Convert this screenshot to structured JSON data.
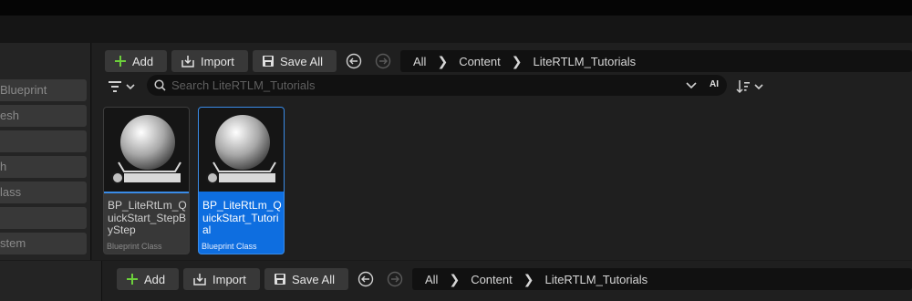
{
  "sidebar": {
    "items": [
      {
        "label": "Blueprint"
      },
      {
        "label": "esh"
      },
      {
        "label": ""
      },
      {
        "label": "h"
      },
      {
        "label": "lass"
      },
      {
        "label": ""
      },
      {
        "label": "stem"
      }
    ]
  },
  "toolbar": {
    "add_label": "Add",
    "import_label": "Import",
    "save_all_label": "Save All"
  },
  "breadcrumb": {
    "items": [
      "All",
      "Content",
      "LiteRTLM_Tutorials"
    ]
  },
  "search": {
    "placeholder": "Search LiteRTLM_Tutorials",
    "ai_label": "AI"
  },
  "assets": [
    {
      "name": "BP_LiteRtLm_QuickStart_StepByStep",
      "class": "Blueprint Class",
      "selected": false
    },
    {
      "name": "BP_LiteRtLm_QuickStart_Tutorial",
      "class": "Blueprint Class",
      "selected": true
    }
  ],
  "lower_toolbar": {
    "add_label": "Add",
    "import_label": "Import",
    "save_all_label": "Save All",
    "breadcrumb": [
      "All",
      "Content",
      "LiteRTLM_Tutorials"
    ]
  },
  "colors": {
    "accent": "#0e6ee0",
    "selection_border": "#3a8ce8",
    "add_icon": "#6ccf3b"
  }
}
